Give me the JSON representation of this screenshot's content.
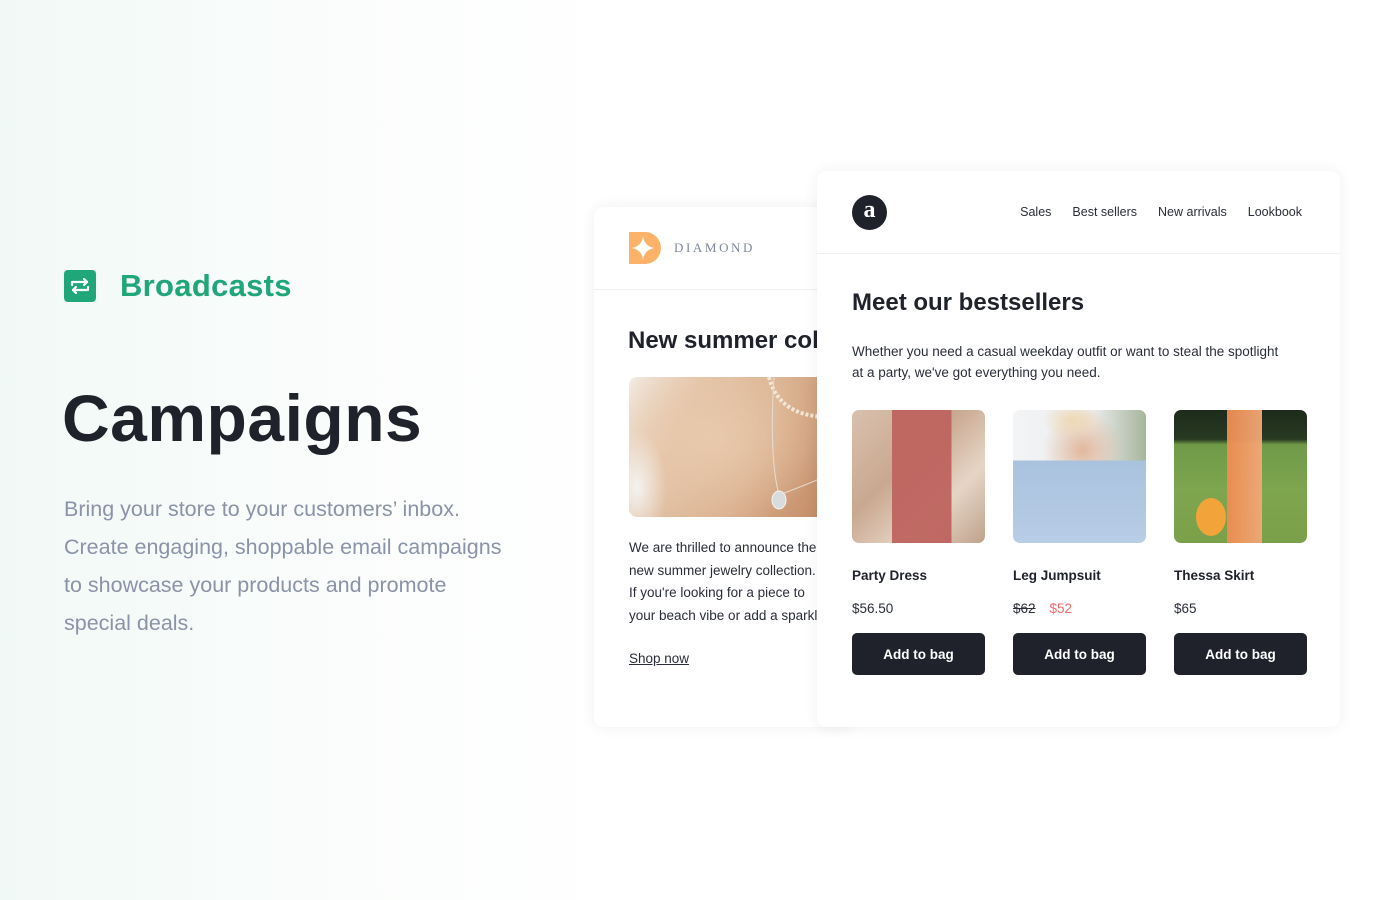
{
  "hero": {
    "brand_label": "Broadcasts",
    "brand_icon": "repeat-arrows-icon",
    "title": "Campaigns",
    "description": "Bring your store to your customers’ inbox. Create engaging, shoppable email campaigns to showcase your products and promote special deals.",
    "accent_color": "#1fa679"
  },
  "diamond_email": {
    "brand_name": "DIAMOND",
    "logo_icon": "diamond-sparkle-logo",
    "logo_color": "#fbb36a",
    "title": "New summer collection",
    "body_lines": [
      "We are thrilled to announce the",
      "new summer jewelry collection.",
      "If you're looking for a piece to",
      "your beach vibe or add a sparkle"
    ],
    "cta_link": "Shop now"
  },
  "bestsellers_email": {
    "logo_letter": "a",
    "nav": [
      "Sales",
      "Best sellers",
      "New arrivals",
      "Lookbook"
    ],
    "title": "Meet our bestsellers",
    "description": "Whether you need a casual weekday outfit or want to steal the spotlight at a party, we've got everything you need.",
    "products": [
      {
        "name": "Party Dress",
        "price": "$56.50",
        "original_price": null,
        "sale_price": null,
        "button": "Add to bag"
      },
      {
        "name": "Leg Jumpsuit",
        "price": null,
        "original_price": "$62",
        "sale_price": "$52",
        "button": "Add to bag"
      },
      {
        "name": "Thessa Skirt",
        "price": "$65",
        "original_price": null,
        "sale_price": null,
        "button": "Add to bag"
      }
    ],
    "sale_color": "#f26b6b",
    "button_color": "#1f222b"
  }
}
